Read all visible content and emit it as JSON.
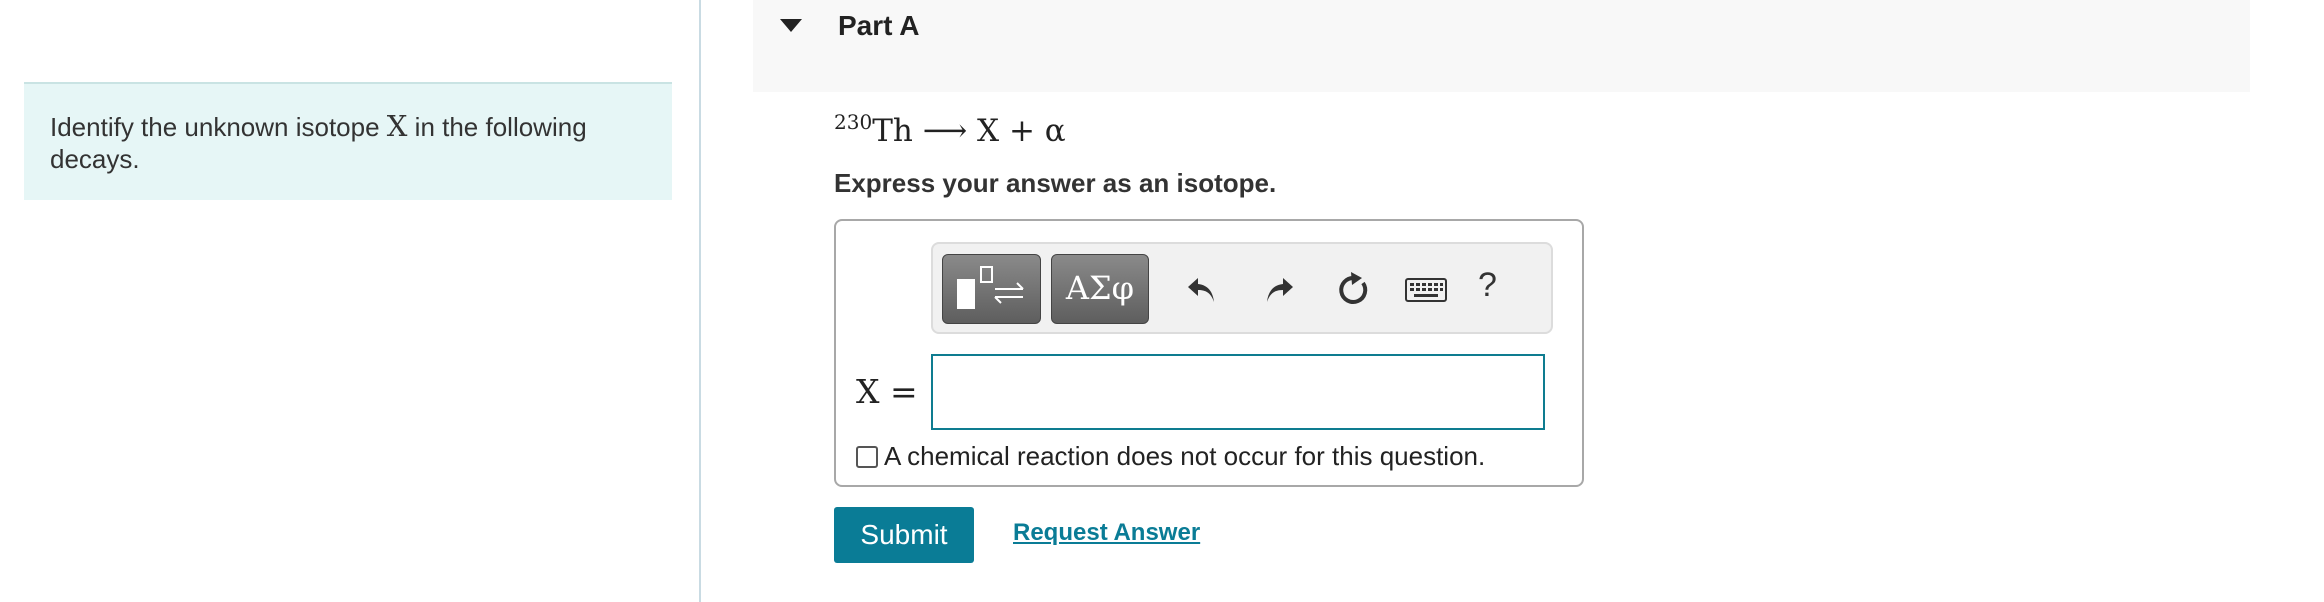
{
  "problem": {
    "text_before": "Identify the unknown isotope ",
    "variable": "X",
    "text_after": " in the following decays."
  },
  "part": {
    "title": "Part A"
  },
  "equation": {
    "mass_number": "230",
    "element": "Th",
    "arrow": "⟶",
    "product": "X",
    "plus": "+",
    "alpha": "α"
  },
  "instruction": "Express your answer as an isotope.",
  "toolbar": {
    "greek_label": "ΑΣφ",
    "help_label": "?",
    "icons": [
      "template-icon",
      "undo-icon",
      "redo-icon",
      "reset-icon",
      "keyboard-icon"
    ]
  },
  "answer": {
    "label": "X =",
    "value": ""
  },
  "no_reaction": {
    "label": "A chemical reaction does not occur for this question.",
    "checked": false
  },
  "actions": {
    "submit_label": "Submit",
    "request_label": "Request Answer"
  },
  "colors": {
    "accent": "#0a7c96",
    "problem_bg": "#e6f6f6",
    "header_bg": "#f8f8f8"
  }
}
